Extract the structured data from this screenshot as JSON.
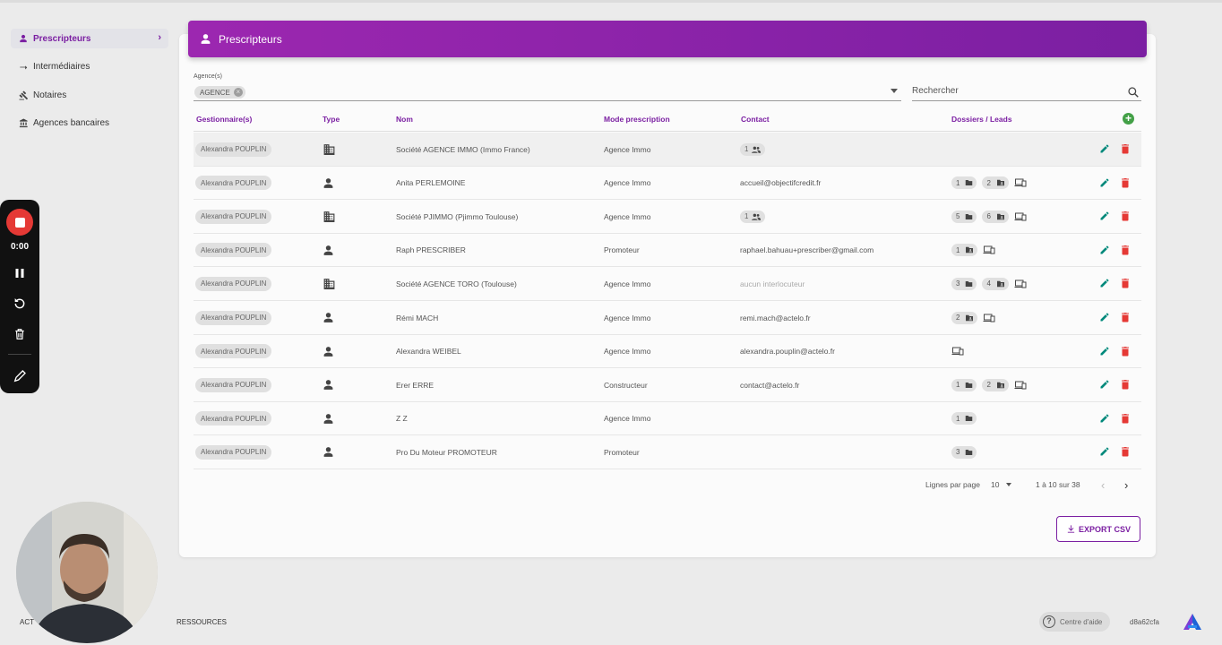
{
  "sidebar": {
    "items": [
      {
        "label": "Prescripteurs",
        "icon": "person-icon",
        "active": true
      },
      {
        "label": "Intermédiaires",
        "icon": "swap-icon",
        "active": false
      },
      {
        "label": "Notaires",
        "icon": "gavel-icon",
        "active": false
      },
      {
        "label": "Agences bancaires",
        "icon": "bank-icon",
        "active": false
      }
    ]
  },
  "recorder": {
    "time": "0:00"
  },
  "header": {
    "title": "Prescripteurs"
  },
  "filter": {
    "label": "Agence(s)",
    "chip": "AGENCE"
  },
  "search": {
    "placeholder": "Rechercher"
  },
  "table": {
    "columns": [
      "Gestionnaire(s)",
      "Type",
      "Nom",
      "Mode prescription",
      "Contact",
      "Dossiers / Leads"
    ],
    "rows": [
      {
        "gestionnaire": "Alexandra POUPLIN",
        "type": "building",
        "nom": "Société AGENCE IMMO (Immo France)",
        "mode": "Agence Immo",
        "contact": "",
        "contact_count": "1",
        "dossiers": "",
        "leads": "",
        "laptop": false
      },
      {
        "gestionnaire": "Alexandra POUPLIN",
        "type": "person",
        "nom": "Anita PERLEMOINE",
        "mode": "Agence Immo",
        "contact": "accueil@objectifcredit.fr",
        "contact_count": "",
        "dossiers": "1",
        "leads": "2",
        "laptop": true
      },
      {
        "gestionnaire": "Alexandra POUPLIN",
        "type": "building",
        "nom": "Société PJIMMO (Pjimmo Toulouse)",
        "mode": "Agence Immo",
        "contact": "",
        "contact_count": "1",
        "dossiers": "5",
        "leads": "6",
        "laptop": true
      },
      {
        "gestionnaire": "Alexandra POUPLIN",
        "type": "person",
        "nom": "Raph PRESCRIBER",
        "mode": "Promoteur",
        "contact": "raphael.bahuau+prescriber@gmail.com",
        "contact_count": "",
        "dossiers": "",
        "leads": "1",
        "laptop": true
      },
      {
        "gestionnaire": "Alexandra POUPLIN",
        "type": "building",
        "nom": "Société AGENCE TORO (Toulouse)",
        "mode": "Agence Immo",
        "contact": "aucun interlocuteur",
        "contact_muted": true,
        "contact_count": "",
        "dossiers": "3",
        "leads": "4",
        "laptop": true
      },
      {
        "gestionnaire": "Alexandra POUPLIN",
        "type": "person",
        "nom": "Rémi MACH",
        "mode": "Agence Immo",
        "contact": "remi.mach@actelo.fr",
        "contact_count": "",
        "dossiers": "",
        "leads": "2",
        "laptop": true
      },
      {
        "gestionnaire": "Alexandra POUPLIN",
        "type": "person",
        "nom": "Alexandra WEIBEL",
        "mode": "Agence Immo",
        "contact": "alexandra.pouplin@actelo.fr",
        "contact_count": "",
        "dossiers": "",
        "leads": "",
        "laptop": true
      },
      {
        "gestionnaire": "Alexandra POUPLIN",
        "type": "person",
        "nom": "Erer ERRE",
        "mode": "Constructeur",
        "contact": "contact@actelo.fr",
        "contact_count": "",
        "dossiers": "1",
        "leads": "2",
        "laptop": true
      },
      {
        "gestionnaire": "Alexandra POUPLIN",
        "type": "person",
        "nom": "Z Z",
        "mode": "Agence Immo",
        "contact": "",
        "contact_count": "",
        "dossiers": "1",
        "leads": "",
        "laptop": false
      },
      {
        "gestionnaire": "Alexandra POUPLIN",
        "type": "person",
        "nom": "Pro Du Moteur PROMOTEUR",
        "mode": "Promoteur",
        "contact": "",
        "contact_count": "",
        "dossiers": "3",
        "leads": "",
        "laptop": false
      }
    ]
  },
  "pagination": {
    "rows_label": "Lignes par page",
    "rows_value": "10",
    "range": "1 à 10 sur 38"
  },
  "export": {
    "label": "EXPORT CSV"
  },
  "footer": {
    "left": "ACT",
    "resources": "RESSOURCES",
    "help": "Centre d'aide",
    "version": "d8a62cfa"
  },
  "colors": {
    "accent": "#7b1fa2",
    "add": "#43a047",
    "edit": "#00897b",
    "delete": "#e53935"
  }
}
